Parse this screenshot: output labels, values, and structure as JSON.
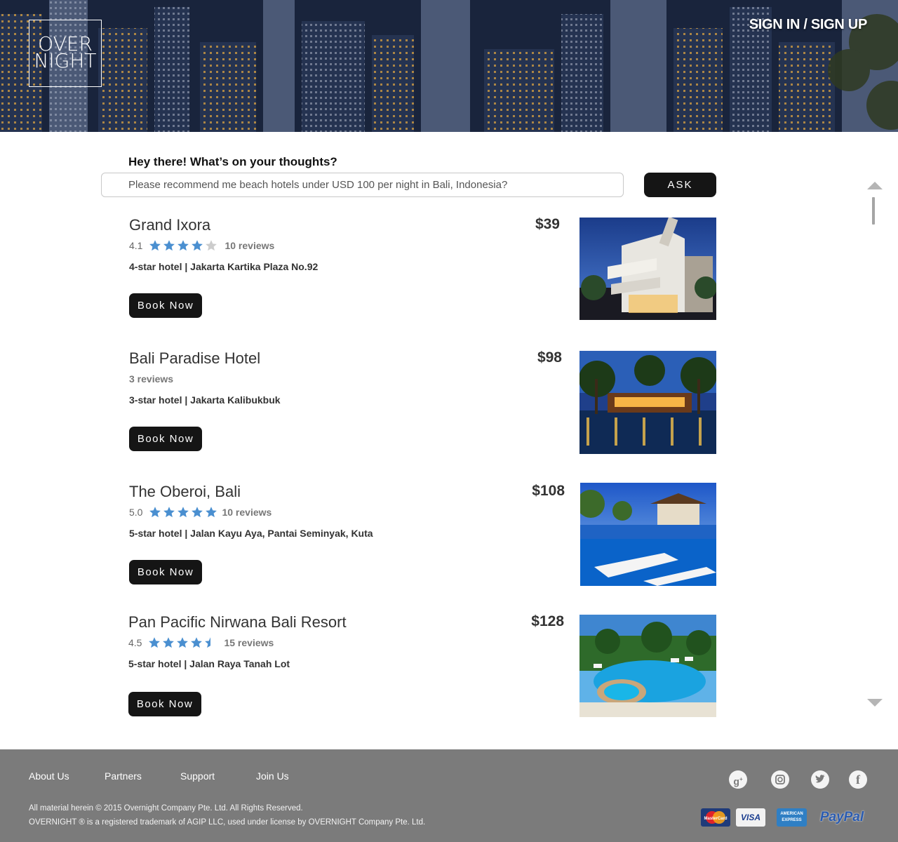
{
  "header": {
    "logo_line1": "OVER",
    "logo_line2": "NIGHT",
    "sign_in_label": "SIGN IN / SIGN UP"
  },
  "query": {
    "label": "Hey there! What’s on your thoughts?",
    "value": "Please recommend me beach hotels under USD 100 per night in Bali, Indonesia?",
    "ask_label": "ASK"
  },
  "hotels": [
    {
      "name": "Grand Ixora",
      "price": "$39",
      "rating": "4.1",
      "stars": 4,
      "reviews": "10 reviews",
      "meta": "4-star hotel | Jakarta Kartika Plaza No.92",
      "book_label": "Book Now"
    },
    {
      "name": "Bali Paradise Hotel",
      "price": "$98",
      "rating": "",
      "stars": 0,
      "reviews": "3 reviews",
      "meta": "3-star hotel | Jakarta Kalibukbuk",
      "book_label": "Book Now"
    },
    {
      "name": "The Oberoi, Bali",
      "price": "$108",
      "rating": "5.0",
      "stars": 5,
      "reviews": "10 reviews",
      "meta": "5-star hotel | Jalan Kayu Aya, Pantai Seminyak, Kuta",
      "book_label": "Book Now"
    },
    {
      "name": "Pan Pacific Nirwana Bali Resort",
      "price": "$128",
      "rating": "4.5",
      "stars": 4.5,
      "reviews": "15 reviews",
      "meta": "5-star hotel | Jalan Raya Tanah Lot",
      "book_label": "Book Now"
    }
  ],
  "footer": {
    "links": [
      "About Us",
      "Partners",
      "Support",
      "Join Us"
    ],
    "copyright_line1": "All material herein © 2015 Overnight Company Pte. Ltd. All Rights Reserved.",
    "copyright_line2": "OVERNIGHT ® is a registered trademark of AGIP LLC, used under license by OVERNIGHT Company Pte. Ltd.",
    "social": [
      "google-plus-icon",
      "instagram-icon",
      "twitter-icon",
      "facebook-icon"
    ],
    "payments": [
      "MasterCard",
      "VISA",
      "AMERICAN EXPRESS",
      "PayPal"
    ]
  },
  "colors": {
    "star_fill": "#4a8fd0",
    "star_empty": "#cccccc",
    "button_bg": "#151515",
    "footer_bg": "#7b7b7b"
  }
}
